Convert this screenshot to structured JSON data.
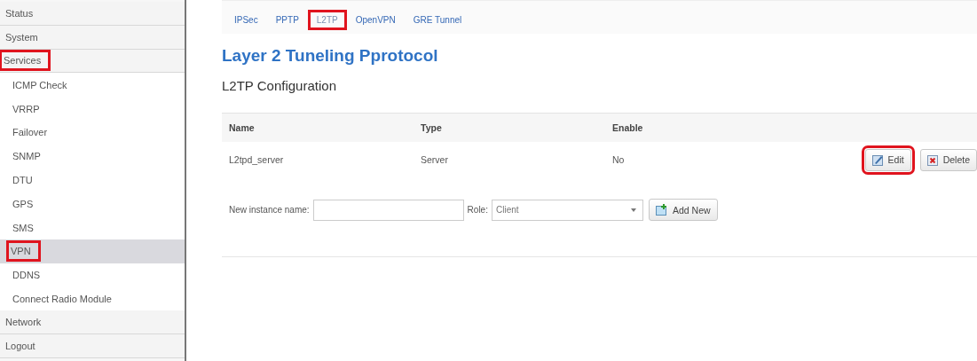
{
  "sidebar": {
    "items": [
      {
        "label": "Status",
        "kind": "top",
        "selected": false,
        "highlighted": false
      },
      {
        "label": "System",
        "kind": "top",
        "selected": false,
        "highlighted": false
      },
      {
        "label": "Services",
        "kind": "top",
        "selected": false,
        "highlighted": true
      },
      {
        "label": "ICMP Check",
        "kind": "sub",
        "selected": false,
        "highlighted": false
      },
      {
        "label": "VRRP",
        "kind": "sub",
        "selected": false,
        "highlighted": false
      },
      {
        "label": "Failover",
        "kind": "sub",
        "selected": false,
        "highlighted": false
      },
      {
        "label": "SNMP",
        "kind": "sub",
        "selected": false,
        "highlighted": false
      },
      {
        "label": "DTU",
        "kind": "sub",
        "selected": false,
        "highlighted": false
      },
      {
        "label": "GPS",
        "kind": "sub",
        "selected": false,
        "highlighted": false
      },
      {
        "label": "SMS",
        "kind": "sub",
        "selected": false,
        "highlighted": false
      },
      {
        "label": "VPN",
        "kind": "sub",
        "selected": true,
        "highlighted": true
      },
      {
        "label": "DDNS",
        "kind": "sub",
        "selected": false,
        "highlighted": false
      },
      {
        "label": "Connect Radio Module",
        "kind": "sub",
        "selected": false,
        "highlighted": false
      },
      {
        "label": "Network",
        "kind": "top",
        "selected": false,
        "highlighted": false
      },
      {
        "label": "Logout",
        "kind": "top",
        "selected": false,
        "highlighted": false
      }
    ]
  },
  "tabs": [
    {
      "label": "IPSec",
      "selected": false,
      "highlighted": false
    },
    {
      "label": "PPTP",
      "selected": false,
      "highlighted": false
    },
    {
      "label": "L2TP",
      "selected": true,
      "highlighted": true
    },
    {
      "label": "OpenVPN",
      "selected": false,
      "highlighted": false
    },
    {
      "label": "GRE Tunnel",
      "selected": false,
      "highlighted": false
    }
  ],
  "title": "Layer 2 Tuneling Pprotocol",
  "section_title": "L2TP Configuration",
  "table": {
    "columns": [
      "Name",
      "Type",
      "Enable"
    ],
    "rows": [
      {
        "cells": [
          "L2tpd_server",
          "Server",
          "No"
        ],
        "edit": {
          "label": "Edit",
          "highlighted": true
        },
        "delete": {
          "label": "Delete",
          "highlighted": false
        }
      }
    ]
  },
  "form": {
    "name_label": "New instance name:",
    "role_label": "Role:",
    "role_value": "Client",
    "add_button": "Add New"
  }
}
